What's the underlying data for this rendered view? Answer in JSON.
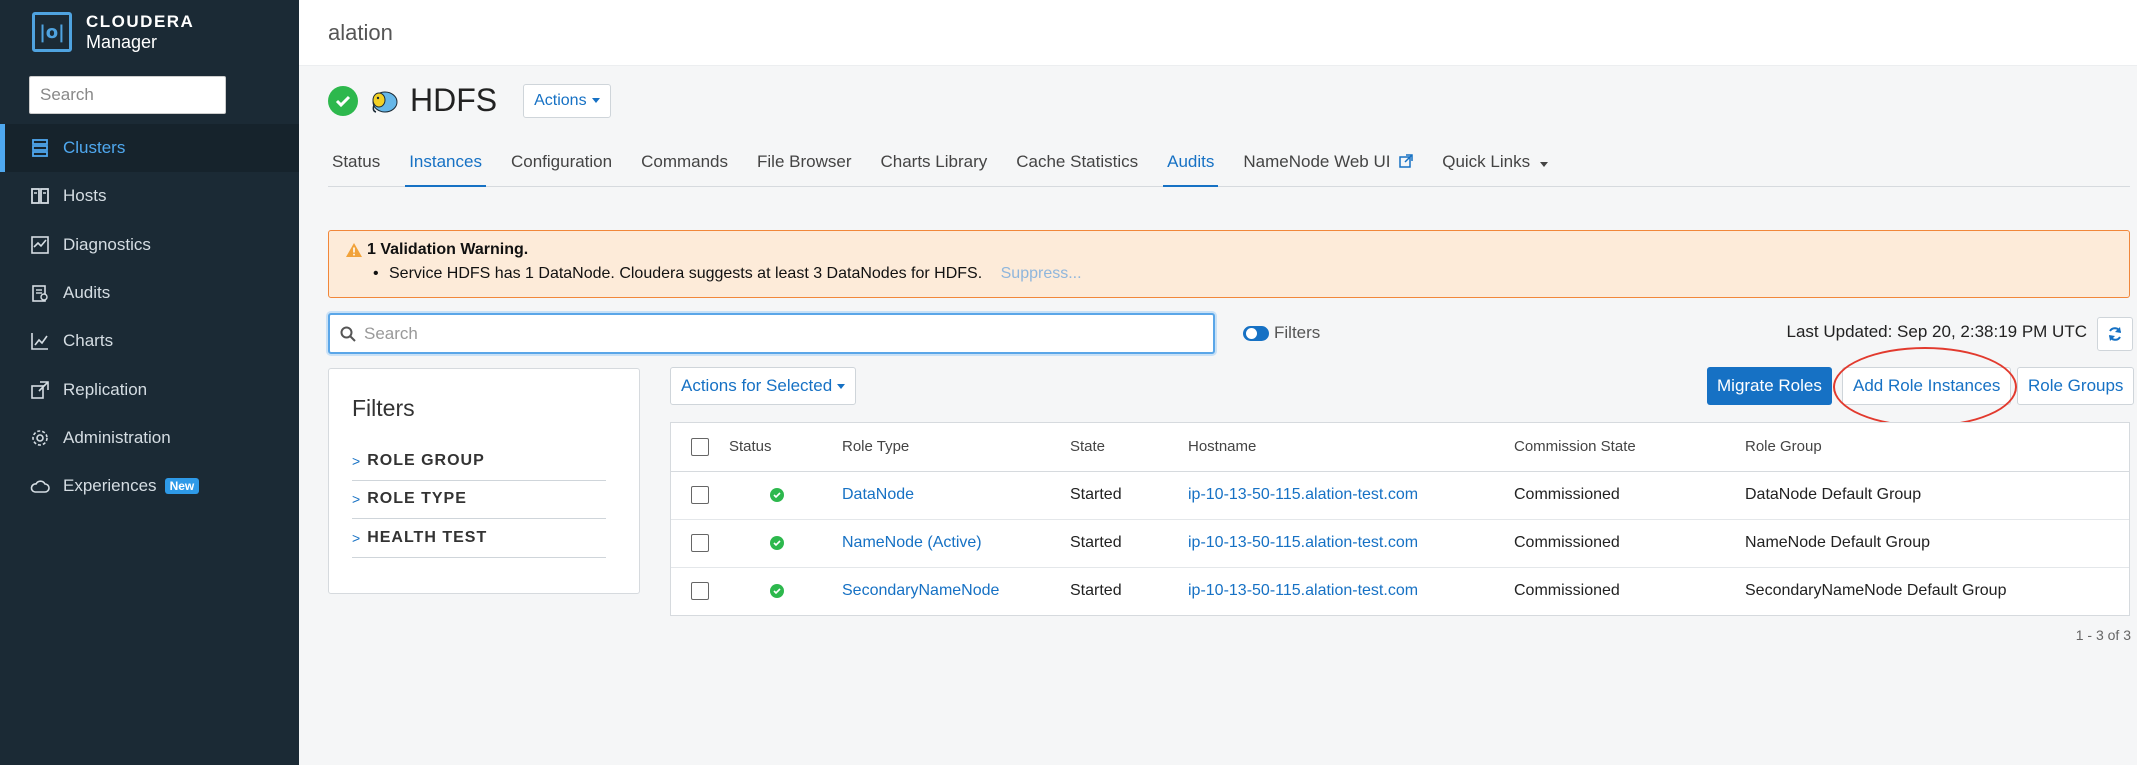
{
  "app": {
    "brand_line1": "CLOUDERA",
    "brand_line2": "Manager"
  },
  "sidebar": {
    "search_placeholder": "Search",
    "items": [
      {
        "label": "Clusters",
        "icon": "clusters-icon",
        "active": true
      },
      {
        "label": "Hosts",
        "icon": "hosts-icon"
      },
      {
        "label": "Diagnostics",
        "icon": "diagnostics-icon"
      },
      {
        "label": "Audits",
        "icon": "audits-icon"
      },
      {
        "label": "Charts",
        "icon": "charts-icon"
      },
      {
        "label": "Replication",
        "icon": "replication-icon"
      },
      {
        "label": "Administration",
        "icon": "gear-icon"
      },
      {
        "label": "Experiences",
        "icon": "cloud-icon",
        "badge": "New"
      }
    ]
  },
  "header": {
    "cluster_name": "alation"
  },
  "service": {
    "name": "HDFS",
    "actions_label": "Actions"
  },
  "tabs": [
    {
      "label": "Status"
    },
    {
      "label": "Instances",
      "active": true
    },
    {
      "label": "Configuration"
    },
    {
      "label": "Commands"
    },
    {
      "label": "File Browser"
    },
    {
      "label": "Charts Library"
    },
    {
      "label": "Cache Statistics"
    },
    {
      "label": "Audits",
      "active": true
    },
    {
      "label": "NameNode Web UI",
      "external": true
    },
    {
      "label": "Quick Links",
      "dropdown": true
    }
  ],
  "warning": {
    "title": "1 Validation Warning.",
    "message": "Service HDFS has 1 DataNode. Cloudera suggests at least 3 DataNodes for HDFS.",
    "suppress_label": "Suppress..."
  },
  "toolbar": {
    "search_placeholder": "Search",
    "filters_label": "Filters",
    "last_updated": "Last Updated: Sep 20, 2:38:19 PM UTC",
    "actions_selected_label": "Actions for Selected",
    "migrate_label": "Migrate Roles",
    "add_role_label": "Add Role Instances",
    "role_groups_label": "Role Groups"
  },
  "filters": {
    "title": "Filters",
    "groups": [
      "ROLE GROUP",
      "ROLE TYPE",
      "HEALTH TEST"
    ]
  },
  "table": {
    "headers": [
      "Status",
      "Role Type",
      "State",
      "Hostname",
      "Commission State",
      "Role Group"
    ],
    "rows": [
      {
        "status": "good",
        "role_type": "DataNode",
        "state": "Started",
        "hostname": "ip-10-13-50-115.alation-test.com",
        "commission": "Commissioned",
        "role_group": "DataNode Default Group"
      },
      {
        "status": "good",
        "role_type": "NameNode (Active)",
        "state": "Started",
        "hostname": "ip-10-13-50-115.alation-test.com",
        "commission": "Commissioned",
        "role_group": "NameNode Default Group"
      },
      {
        "status": "good",
        "role_type": "SecondaryNameNode",
        "state": "Started",
        "hostname": "ip-10-13-50-115.alation-test.com",
        "commission": "Commissioned",
        "role_group": "SecondaryNameNode Default Group"
      }
    ],
    "pager": "1 - 3 of 3"
  },
  "colors": {
    "sidebar_bg": "#1b2a35",
    "accent": "#1671c4",
    "ok": "#2db84d",
    "warning_border": "#f1873a",
    "annotation": "#e23a2e"
  }
}
